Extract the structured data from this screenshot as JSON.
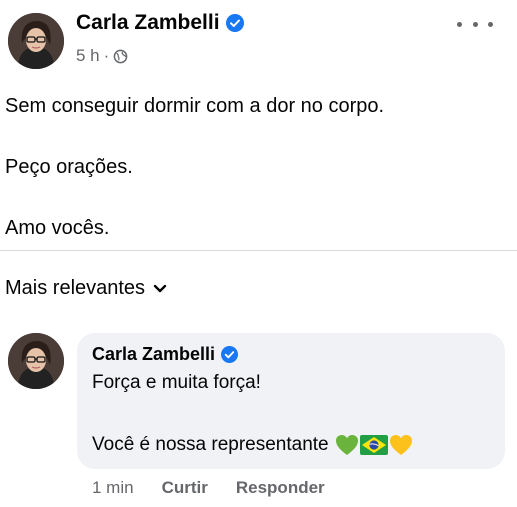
{
  "post": {
    "author": "Carla Zambelli",
    "time": "5 h",
    "separator": "·",
    "lines": [
      "Sem conseguir dormir com a dor no corpo.",
      "Peço orações.",
      "Amo vocês."
    ],
    "icons": {
      "avatar": "profile-photo",
      "verified": "verified-badge-icon",
      "audience": "globe-icon",
      "more": "more-options-icon"
    }
  },
  "comments": {
    "sort_label": "Mais relevantes",
    "items": [
      {
        "author": "Carla Zambelli",
        "lines": [
          "Força e muita força!",
          "Você é nossa representante"
        ],
        "emojis": [
          "green-heart",
          "brazil-flag",
          "yellow-heart"
        ],
        "time": "1 min",
        "like_label": "Curtir",
        "reply_label": "Responder"
      }
    ]
  },
  "colors": {
    "verified": "#1877f2",
    "secondary_text": "#65676b",
    "bubble": "#f0f2f5",
    "text": "#050505"
  }
}
